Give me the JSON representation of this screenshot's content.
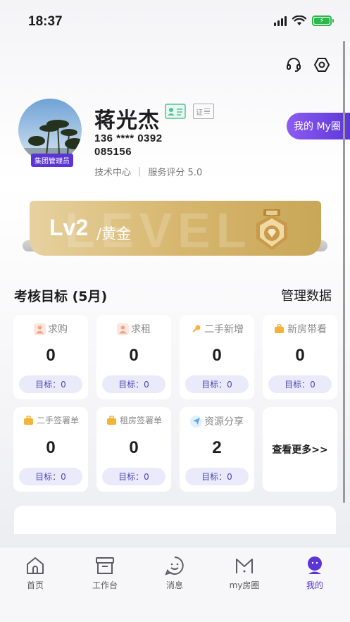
{
  "status_bar": {
    "time": "18:37"
  },
  "profile": {
    "name": "蒋光杰",
    "phone": "136 **** 0392",
    "code": "085156",
    "department": "技术中心",
    "service_rating": "服务评分 5.0",
    "role_badge": "集团管理员",
    "cert_label": "证"
  },
  "my_circle_button": "我的 My圈",
  "level": {
    "lv": "Lv2",
    "tier": "/黄金",
    "watermark": "LEVEL"
  },
  "assessment": {
    "title": "考核目标 (5月)",
    "manage_link": "管理数据",
    "cards": [
      {
        "label": "求购",
        "value": "0",
        "target": "目标：0",
        "icon": "person-icon",
        "icon_color": "#f0a48a"
      },
      {
        "label": "求租",
        "value": "0",
        "target": "目标：0",
        "icon": "person-icon",
        "icon_color": "#f0a48a"
      },
      {
        "label": "二手新增",
        "value": "0",
        "target": "目标：0",
        "icon": "key-icon",
        "icon_color": "#f3b63c"
      },
      {
        "label": "新房带看",
        "value": "0",
        "target": "目标：0",
        "icon": "briefcase-icon",
        "icon_color": "#f4b338"
      },
      {
        "label": "二手签署单",
        "value": "0",
        "target": "目标：0",
        "icon": "briefcase-icon",
        "icon_color": "#f4b338"
      },
      {
        "label": "租房签署单",
        "value": "0",
        "target": "目标：0",
        "icon": "briefcase-icon",
        "icon_color": "#f4b338"
      },
      {
        "label": "资源分享",
        "value": "2",
        "target": "目标：0",
        "icon": "send-icon",
        "icon_color": "#5da7f0"
      }
    ],
    "more": "查看更多>>"
  },
  "tabbar": {
    "items": [
      {
        "label": "首页",
        "icon": "home-icon"
      },
      {
        "label": "工作台",
        "icon": "archive-icon"
      },
      {
        "label": "消息",
        "icon": "message-icon"
      },
      {
        "label": "my房圈",
        "icon": "circle-m-icon"
      },
      {
        "label": "我的",
        "icon": "profile-icon"
      }
    ],
    "active_color": "#5b35d5"
  }
}
